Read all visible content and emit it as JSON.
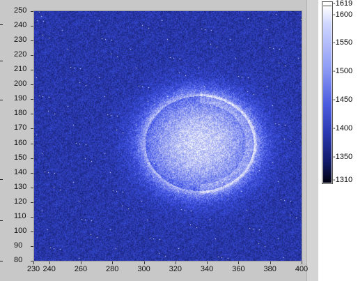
{
  "graph": {
    "y_axis": {
      "ticks": [
        "250",
        "240",
        "230",
        "220",
        "210",
        "200",
        "190",
        "180",
        "170",
        "160",
        "150",
        "140",
        "130",
        "120",
        "110",
        "100",
        "90",
        "80"
      ],
      "min": 80,
      "max": 250
    },
    "x_axis": {
      "ticks": [
        "230",
        "240",
        "260",
        "280",
        "300",
        "320",
        "340",
        "360",
        "380",
        "400"
      ],
      "values": [
        230,
        240,
        260,
        280,
        300,
        320,
        340,
        360,
        380,
        400
      ],
      "min": 230,
      "max": 400
    }
  },
  "color_scale": {
    "ticks": [
      "1619",
      "1600",
      "1550",
      "1500",
      "1450",
      "1400",
      "1350",
      "1310"
    ],
    "values": [
      1619,
      1600,
      1550,
      1500,
      1450,
      1400,
      1350,
      1310
    ],
    "min": 1310,
    "max": 1619,
    "colors": {
      "high": "#ffffff",
      "mid": "#4d5de0",
      "low": "#000010"
    }
  }
}
